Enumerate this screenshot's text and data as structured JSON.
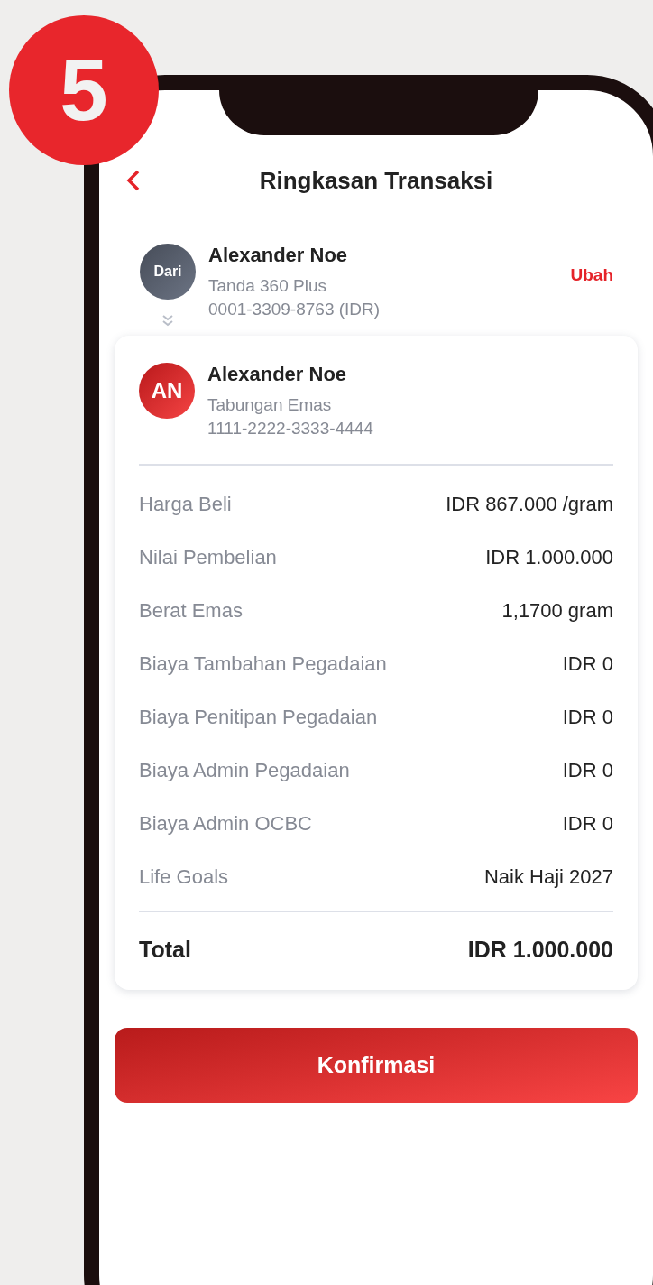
{
  "step_badge": "5",
  "header": {
    "title": "Ringkasan Transaksi"
  },
  "sender": {
    "avatar_label": "Dari",
    "name": "Alexander Noe",
    "product": "Tanda 360 Plus",
    "account": "0001-3309-8763 (IDR)",
    "change_link": "Ubah"
  },
  "recipient": {
    "initials": "AN",
    "name": "Alexander Noe",
    "product": "Tabungan Emas",
    "account": "1111-2222-3333-4444"
  },
  "details": [
    {
      "label": "Harga Beli",
      "value": "IDR 867.000 /gram"
    },
    {
      "label": "Nilai Pembelian",
      "value": "IDR 1.000.000"
    },
    {
      "label": "Berat Emas",
      "value": "1,1700 gram"
    },
    {
      "label": "Biaya Tambahan Pegadaian",
      "value": "IDR 0"
    },
    {
      "label": "Biaya Penitipan Pegadaian",
      "value": "IDR 0"
    },
    {
      "label": "Biaya Admin Pegadaian",
      "value": "IDR 0"
    },
    {
      "label": "Biaya Admin OCBC",
      "value": "IDR 0"
    },
    {
      "label": "Life Goals",
      "value": "Naik Haji 2027"
    }
  ],
  "total": {
    "label": "Total",
    "value": "IDR 1.000.000"
  },
  "confirm_button": "Konfirmasi"
}
